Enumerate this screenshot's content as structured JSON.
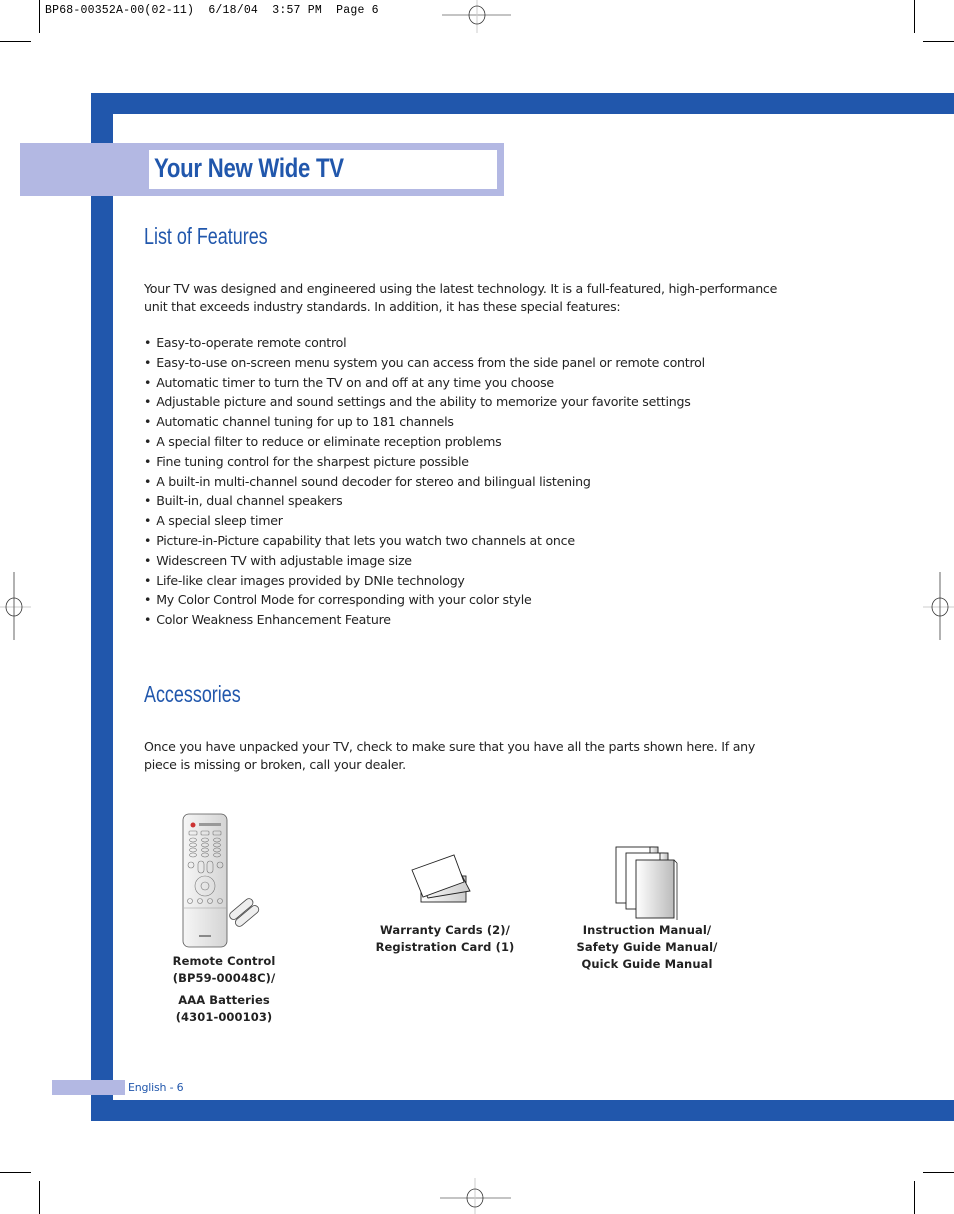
{
  "slug": "BP68-00352A-00(02-11)  6/18/04  3:57 PM  Page 6",
  "page_title": "Your New Wide TV",
  "features_section": {
    "heading": "List of Features",
    "intro_line1": "Your TV was designed and engineered using the latest technology. It is a full-featured, high-performance",
    "intro_line2": "unit that exceeds industry standards. In addition, it has these special features:",
    "items": [
      "Easy-to-operate remote control",
      "Easy-to-use on-screen menu system you can access from the side panel or remote control",
      "Automatic timer to turn the TV on and off at any time you choose",
      "Adjustable picture and sound settings and the ability to memorize your favorite settings",
      "Automatic channel tuning for up to 181 channels",
      "A special filter to reduce or eliminate reception problems",
      "Fine tuning control for the sharpest picture possible",
      "A built-in multi-channel sound decoder for stereo and bilingual listening",
      "Built-in, dual channel speakers",
      "A special sleep timer",
      "Picture-in-Picture capability that lets you watch two channels at once",
      "Widescreen TV with adjustable image size",
      "Life-like clear images provided by DNIe technology",
      "My Color Control Mode for corresponding with your color style",
      "Color Weakness Enhancement Feature"
    ]
  },
  "accessories_section": {
    "heading": "Accessories",
    "intro_line1": "Once you have unpacked your TV, check to make sure that you have all the parts shown here. If any",
    "intro_line2": "piece is missing or broken, call your dealer.",
    "items": [
      {
        "icon": "remote-control-icon",
        "lines": [
          "Remote Control",
          "(BP59-00048C)/"
        ],
        "extra_lines": [
          "AAA Batteries",
          "(4301-000103)"
        ]
      },
      {
        "icon": "cards-icon",
        "lines": [
          "Warranty Cards (2)/",
          "Registration Card (1)"
        ]
      },
      {
        "icon": "manuals-icon",
        "lines": [
          "Instruction Manual/",
          "Safety Guide Manual/",
          "Quick Guide Manual"
        ]
      }
    ]
  },
  "footer": {
    "page_label": "English - 6"
  },
  "colors": {
    "brand_blue": "#2157ac",
    "light_band": "#b3b8e3"
  }
}
